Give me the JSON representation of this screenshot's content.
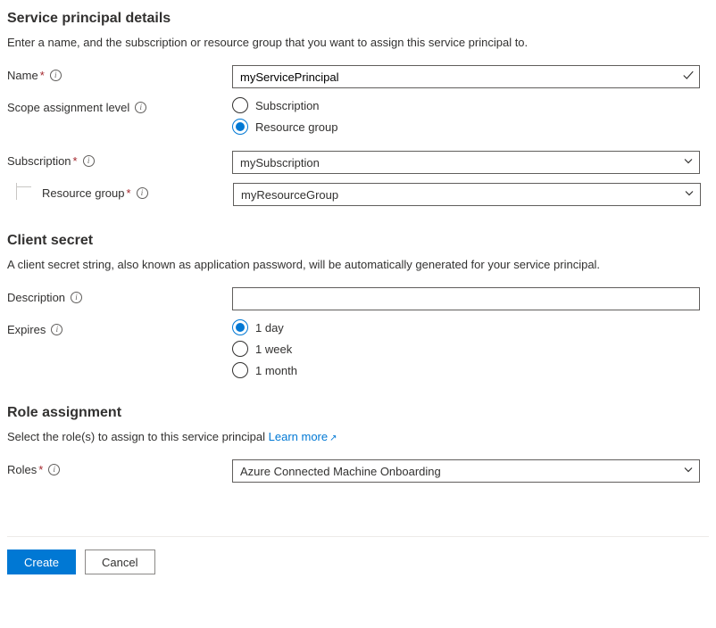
{
  "sp_details": {
    "heading": "Service principal details",
    "description": "Enter a name, and the subscription or resource group that you want to assign this service principal to.",
    "name_label": "Name",
    "name_value": "myServicePrincipal",
    "scope_label": "Scope assignment level",
    "scope_options": {
      "subscription": "Subscription",
      "resource_group": "Resource group"
    },
    "scope_selected": "resource_group",
    "subscription_label": "Subscription",
    "subscription_value": "mySubscription",
    "resource_group_label": "Resource group",
    "resource_group_value": "myResourceGroup"
  },
  "client_secret": {
    "heading": "Client secret",
    "description": "A client secret string, also known as application password, will be automatically generated for your service principal.",
    "description_label": "Description",
    "description_value": "",
    "expires_label": "Expires",
    "expires_options": {
      "day": "1 day",
      "week": "1 week",
      "month": "1 month"
    },
    "expires_selected": "day"
  },
  "role_assignment": {
    "heading": "Role assignment",
    "description_prefix": "Select the role(s) to assign to this service principal ",
    "learn_more": "Learn more",
    "roles_label": "Roles",
    "roles_value": "Azure Connected Machine Onboarding"
  },
  "footer": {
    "create": "Create",
    "cancel": "Cancel"
  }
}
